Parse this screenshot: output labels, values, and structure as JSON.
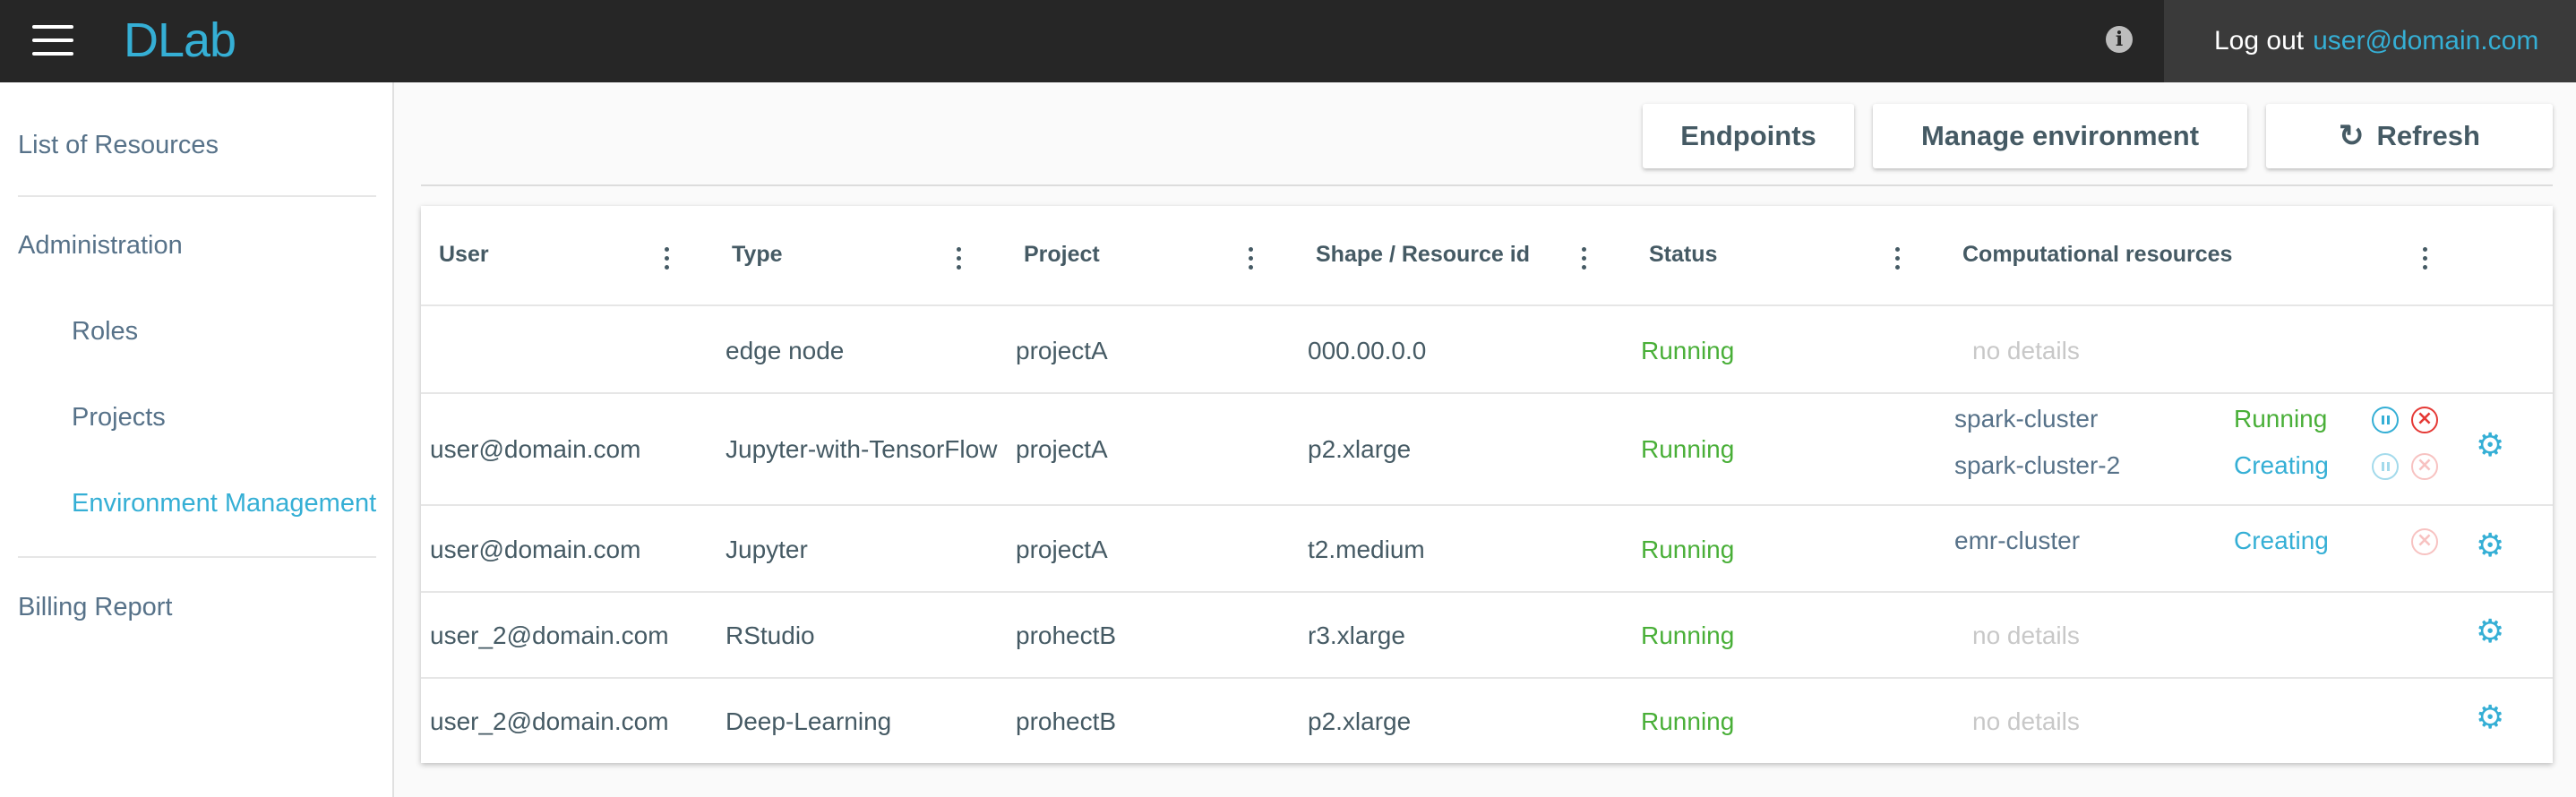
{
  "header": {
    "logo": "DLab",
    "logout_label": "Log out",
    "user": "user@domain.com",
    "info_icon": "info-icon",
    "menu_icon": "hamburger-menu-icon"
  },
  "sidebar": {
    "items": [
      {
        "label": "List of Resources"
      },
      {
        "label": "Administration"
      },
      {
        "label": "Roles"
      },
      {
        "label": "Projects"
      },
      {
        "label": "Environment Management",
        "active": true
      },
      {
        "label": "Billing Report"
      }
    ]
  },
  "toolbar": {
    "endpoints": "Endpoints",
    "manage_environment": "Manage environment",
    "refresh": "Refresh"
  },
  "table": {
    "columns": [
      "User",
      "Type",
      "Project",
      "Shape / Resource id",
      "Status",
      "Computational resources"
    ],
    "rows": [
      {
        "user": "",
        "type": "edge node",
        "project": "projectA",
        "shape": "000.00.0.0",
        "status": "Running",
        "computational": [],
        "no_details": "no details"
      },
      {
        "user": "user@domain.com",
        "type": "Jupyter-with-TensorFlow",
        "project": "projectA",
        "shape": "p2.xlarge",
        "status": "Running",
        "computational": [
          {
            "name": "spark-cluster",
            "status": "Running"
          },
          {
            "name": "spark-cluster-2",
            "status": "Creating"
          }
        ]
      },
      {
        "user": "user@domain.com",
        "type": "Jupyter",
        "project": "projectA",
        "shape": "t2.medium",
        "status": "Running",
        "computational": [
          {
            "name": "emr-cluster",
            "status": "Creating"
          }
        ]
      },
      {
        "user": "user_2@domain.com",
        "type": "RStudio",
        "project": "prohectB",
        "shape": "r3.xlarge",
        "status": "Running",
        "computational": [],
        "no_details": "no details"
      },
      {
        "user": "user_2@domain.com",
        "type": "Deep-Learning",
        "project": "prohectB",
        "shape": "p2.xlarge",
        "status": "Running",
        "computational": [],
        "no_details": "no details"
      }
    ]
  },
  "colors": {
    "topbar": "#262626",
    "accent": "#35afd5",
    "running": "#49af38",
    "stop": "#e53935",
    "text": "#455a64"
  }
}
